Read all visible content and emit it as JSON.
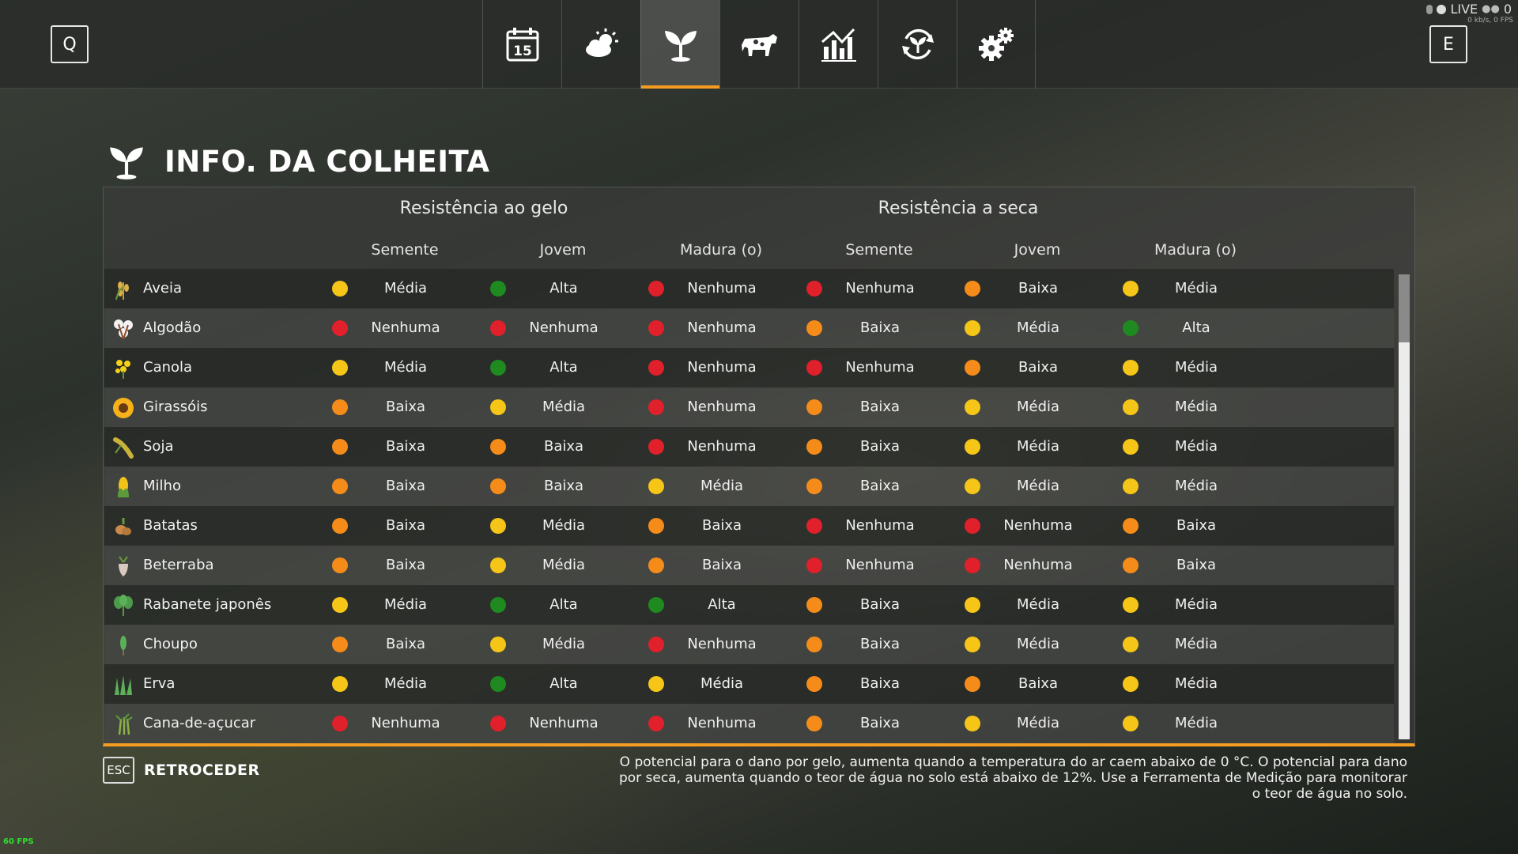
{
  "header": {
    "key_left": "Q",
    "key_right": "E",
    "calendar_day": "15",
    "tabs": [
      {
        "name": "tab-calendar",
        "icon": "calendar-icon",
        "active": false
      },
      {
        "name": "tab-weather",
        "icon": "weather-icon",
        "active": false
      },
      {
        "name": "tab-crops",
        "icon": "sprout-icon",
        "active": true
      },
      {
        "name": "tab-animals",
        "icon": "cow-icon",
        "active": false
      },
      {
        "name": "tab-prices",
        "icon": "price-chart-icon",
        "active": false
      },
      {
        "name": "tab-rotation",
        "icon": "crop-rotation-icon",
        "active": false
      },
      {
        "name": "tab-settings",
        "icon": "gears-icon",
        "active": false
      }
    ],
    "live_label": "LIVE",
    "live_count": "0",
    "bandwidth": "0 kb/s, 0 FPS"
  },
  "page": {
    "title": "INFO. DA COLHEITA",
    "title_icon": "sprout-icon"
  },
  "table": {
    "group_frost": "Resistência ao gelo",
    "group_drought": "Resistência a seca",
    "stage_headers": [
      "Semente",
      "Jovem",
      "Madura (o)",
      "Semente",
      "Jovem",
      "Madura (o)"
    ],
    "rows": [
      {
        "crop": "Aveia",
        "icon": "oat-icon",
        "values": [
          "Média",
          "Alta",
          "Nenhuma",
          "Nenhuma",
          "Baixa",
          "Média"
        ]
      },
      {
        "crop": "Algodão",
        "icon": "cotton-icon",
        "values": [
          "Nenhuma",
          "Nenhuma",
          "Nenhuma",
          "Baixa",
          "Média",
          "Alta"
        ]
      },
      {
        "crop": "Canola",
        "icon": "canola-icon",
        "values": [
          "Média",
          "Alta",
          "Nenhuma",
          "Nenhuma",
          "Baixa",
          "Média"
        ]
      },
      {
        "crop": "Girassóis",
        "icon": "sunflower-icon",
        "values": [
          "Baixa",
          "Média",
          "Nenhuma",
          "Baixa",
          "Média",
          "Média"
        ]
      },
      {
        "crop": "Soja",
        "icon": "soybean-icon",
        "values": [
          "Baixa",
          "Baixa",
          "Nenhuma",
          "Baixa",
          "Média",
          "Média"
        ]
      },
      {
        "crop": "Milho",
        "icon": "corn-icon",
        "values": [
          "Baixa",
          "Baixa",
          "Média",
          "Baixa",
          "Média",
          "Média"
        ]
      },
      {
        "crop": "Batatas",
        "icon": "potato-icon",
        "values": [
          "Baixa",
          "Média",
          "Baixa",
          "Nenhuma",
          "Nenhuma",
          "Baixa"
        ]
      },
      {
        "crop": "Beterraba",
        "icon": "beet-icon",
        "values": [
          "Baixa",
          "Média",
          "Baixa",
          "Nenhuma",
          "Nenhuma",
          "Baixa"
        ]
      },
      {
        "crop": "Rabanete japonês",
        "icon": "radish-icon",
        "values": [
          "Média",
          "Alta",
          "Alta",
          "Baixa",
          "Média",
          "Média"
        ]
      },
      {
        "crop": "Choupo",
        "icon": "poplar-icon",
        "values": [
          "Baixa",
          "Média",
          "Nenhuma",
          "Baixa",
          "Média",
          "Média"
        ]
      },
      {
        "crop": "Erva",
        "icon": "grass-icon",
        "values": [
          "Média",
          "Alta",
          "Média",
          "Baixa",
          "Baixa",
          "Média"
        ]
      },
      {
        "crop": "Cana-de-açucar",
        "icon": "sugarcane-icon",
        "values": [
          "Nenhuma",
          "Nenhuma",
          "Nenhuma",
          "Baixa",
          "Média",
          "Média"
        ]
      }
    ],
    "level_colors": {
      "Alta": "#1f8a1f",
      "Média": "#f5c518",
      "Baixa": "#f58c1a",
      "Nenhuma": "#e0202a"
    },
    "scroll_position": 0.0
  },
  "footer": {
    "esc_key": "ESC",
    "back_label": "RETROCEDER",
    "help_line1": "O potencial para o dano por gelo, aumenta quando a temperatura do ar caem abaixo de 0 °C. O potencial para dano",
    "help_line2": "por seca, aumenta quando o teor de água no solo está abaixo de 12%. Use a Ferramenta de Medição para monitorar",
    "help_line3": "o teor de água no solo.",
    "fps": "60 FPS"
  },
  "colors": {
    "accent": "#f59d23"
  }
}
